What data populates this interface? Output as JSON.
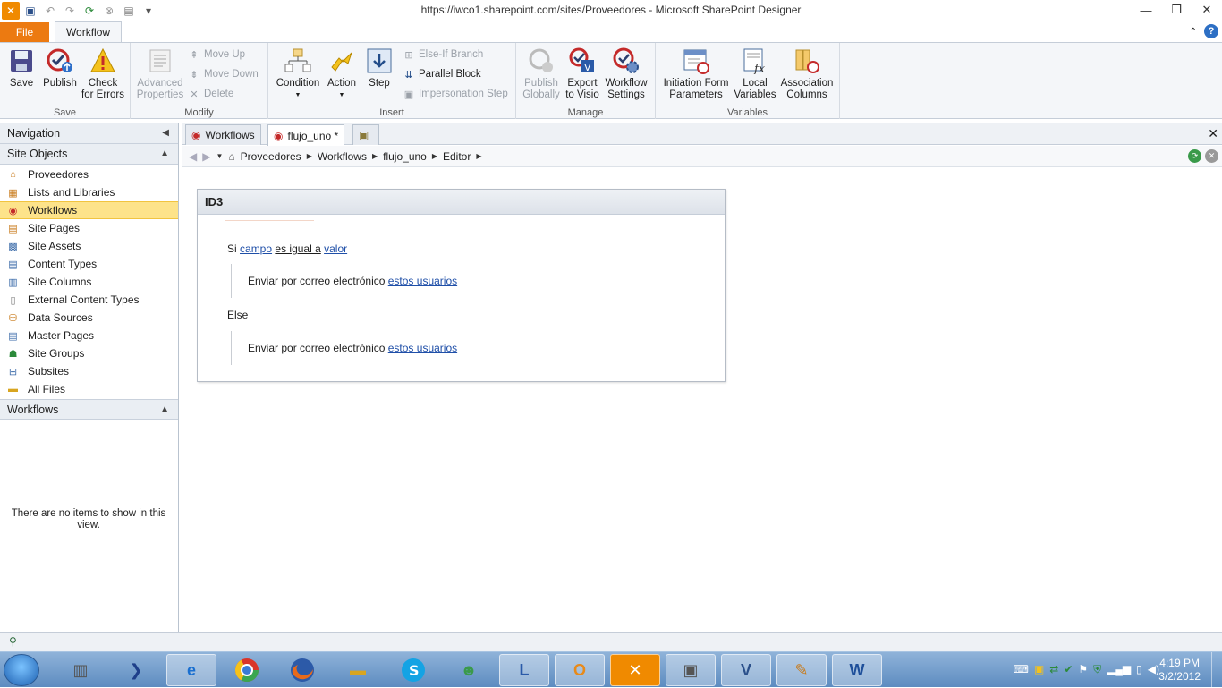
{
  "window": {
    "title": "https://iwco1.sharepoint.com/sites/Proveedores  -  Microsoft SharePoint Designer"
  },
  "ribbon_tabs": {
    "file": "File",
    "workflow": "Workflow"
  },
  "ribbon": {
    "save_group": {
      "label": "Save",
      "save": "Save",
      "publish": "Publish",
      "check1": "Check",
      "check2": "for Errors"
    },
    "modify_group": {
      "label": "Modify",
      "advanced1": "Advanced",
      "advanced2": "Properties",
      "move_up": "Move Up",
      "move_down": "Move Down",
      "delete": "Delete"
    },
    "insert_group": {
      "label": "Insert",
      "condition": "Condition",
      "action": "Action",
      "step": "Step",
      "else_if": "Else-If Branch",
      "parallel": "Parallel Block",
      "impersonation": "Impersonation Step"
    },
    "manage_group": {
      "label": "Manage",
      "publish1": "Publish",
      "publish2": "Globally",
      "export1": "Export",
      "export2": "to Visio",
      "settings1": "Workflow",
      "settings2": "Settings"
    },
    "variables_group": {
      "label": "Variables",
      "init1": "Initiation Form",
      "init2": "Parameters",
      "local1": "Local",
      "local2": "Variables",
      "assoc1": "Association",
      "assoc2": "Columns"
    }
  },
  "navigation": {
    "title": "Navigation",
    "site_objects": "Site Objects",
    "items": [
      {
        "label": "Proveedores"
      },
      {
        "label": "Lists and Libraries"
      },
      {
        "label": "Workflows"
      },
      {
        "label": "Site Pages"
      },
      {
        "label": "Site Assets"
      },
      {
        "label": "Content Types"
      },
      {
        "label": "Site Columns"
      },
      {
        "label": "External Content Types"
      },
      {
        "label": "Data Sources"
      },
      {
        "label": "Master Pages"
      },
      {
        "label": "Site Groups"
      },
      {
        "label": "Subsites"
      },
      {
        "label": "All Files"
      }
    ],
    "workflows_section": "Workflows",
    "empty_message": "There are no items to show in this view."
  },
  "doc_tabs": {
    "tab1": "Workflows",
    "tab2": "flujo_uno *"
  },
  "breadcrumb": {
    "b1": "Proveedores",
    "b2": "Workflows",
    "b3": "flujo_uno",
    "b4": "Editor"
  },
  "workflow": {
    "step_title": "ID3",
    "if_prefix": "Si",
    "field": "campo",
    "operator": "es igual a",
    "value": "valor",
    "action1_text": "Enviar por correo electrónico",
    "action1_link": "estos usuarios",
    "else_label": "Else",
    "action2_text": "Enviar por correo electrónico",
    "action2_link": "estos usuarios"
  },
  "taskbar": {
    "time": "4:19 PM",
    "date": "3/2/2012"
  }
}
